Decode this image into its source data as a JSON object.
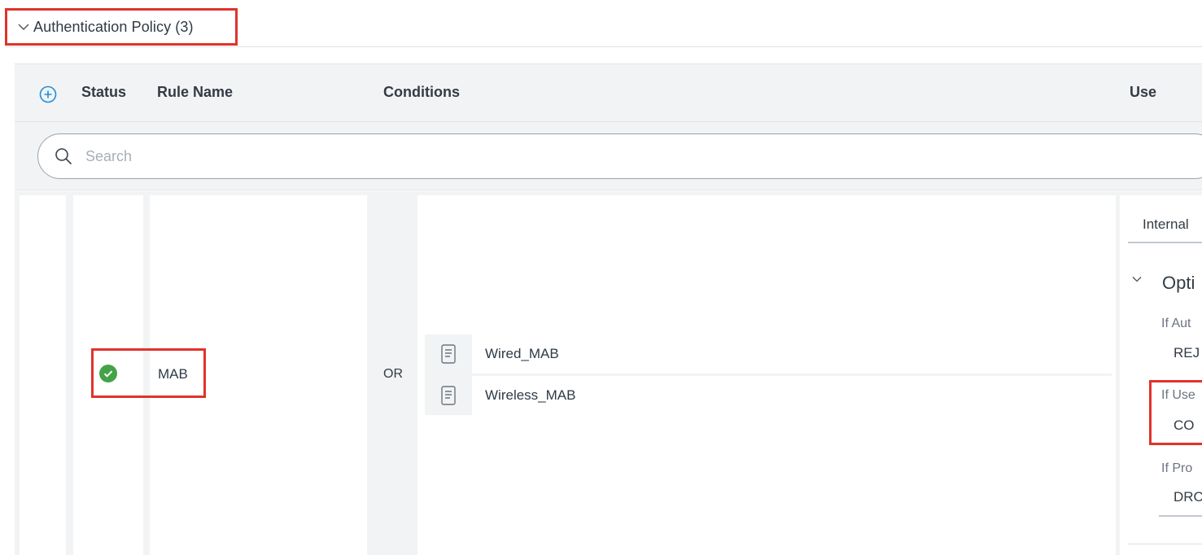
{
  "section": {
    "title": "Authentication Policy (3)"
  },
  "table": {
    "columns": {
      "status": "Status",
      "rule_name": "Rule Name",
      "conditions": "Conditions",
      "use": "Use"
    },
    "search_placeholder": "Search"
  },
  "rule": {
    "name": "MAB",
    "status": "enabled",
    "operator": "OR",
    "conditions": [
      {
        "label": "Wired_MAB",
        "icon": "condition-library-icon"
      },
      {
        "label": "Wireless_MAB",
        "icon": "condition-library-icon"
      }
    ]
  },
  "use": {
    "identity_store": "Internal",
    "options_label": "Opti",
    "auth_fail_label": "If Aut",
    "auth_fail_value": "REJ",
    "user_not_found_label": "If Use",
    "user_not_found_value": "CO",
    "process_fail_label": "If Pro",
    "process_fail_value": "DRO"
  },
  "colors": {
    "highlight": "#e0332b",
    "status_enabled": "#44a348",
    "accent": "#1e8fd8"
  }
}
